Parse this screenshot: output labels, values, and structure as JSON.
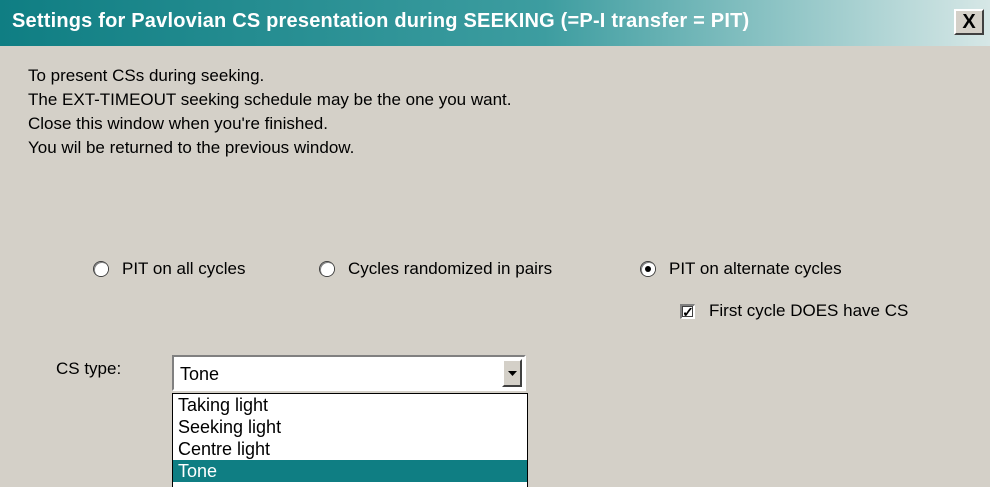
{
  "window": {
    "title": "Settings for Pavlovian CS presentation during SEEKING (=P-I transfer = PIT)",
    "close_label": "X"
  },
  "instructions": [
    "To present CSs during seeking.",
    "The EXT-TIMEOUT seeking schedule may be the one you want.",
    "Close this window when you're finished.",
    "You wil be returned to the previous window."
  ],
  "pit_mode": {
    "options": [
      {
        "label": "PIT on all cycles",
        "checked": false
      },
      {
        "label": "Cycles randomized in pairs",
        "checked": false
      },
      {
        "label": "PIT on alternate cycles",
        "checked": true
      }
    ]
  },
  "first_cycle": {
    "label": "First cycle DOES have CS",
    "checked": true
  },
  "cs_type": {
    "label": "CS type:",
    "value": "Tone",
    "options": [
      "Taking light",
      "Seeking light",
      "Centre light",
      "Tone"
    ],
    "highlighted": "Tone"
  },
  "colors": {
    "title_start": "#0f7e83",
    "title_end": "#d6e7e6",
    "face": "#d4d0c8",
    "highlight": "#0f7e83"
  }
}
